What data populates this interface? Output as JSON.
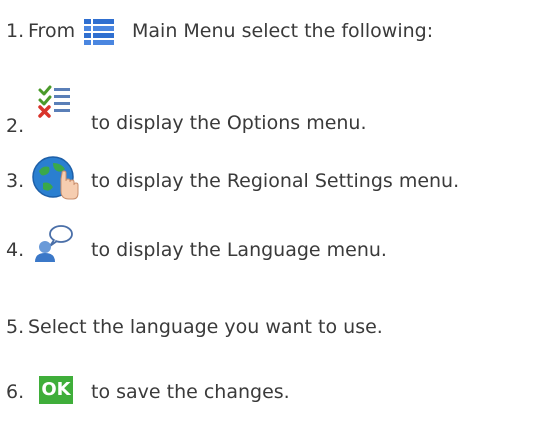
{
  "steps": [
    {
      "number": "1.",
      "prefix": "From",
      "icon": "main-menu-list-icon",
      "text": "Main Menu select the following:"
    },
    {
      "number": "2.",
      "icon": "options-checklist-icon",
      "text": "to display the Options menu."
    },
    {
      "number": "3.",
      "icon": "regional-globe-hand-icon",
      "text": "to display the Regional Settings menu."
    },
    {
      "number": "4.",
      "icon": "language-speech-person-icon",
      "text": "to display the Language menu."
    },
    {
      "number": "5.",
      "text": "Select the language you want to use."
    },
    {
      "number": "6.",
      "icon": "ok-button-icon",
      "icon_label": "OK",
      "text": "to save the changes."
    }
  ],
  "colors": {
    "text": "#3a3a3a",
    "ok_green": "#3fae3a",
    "menu_blue": "#2f6fd0",
    "check_green": "#4a9a2a",
    "x_red": "#d9342b"
  }
}
